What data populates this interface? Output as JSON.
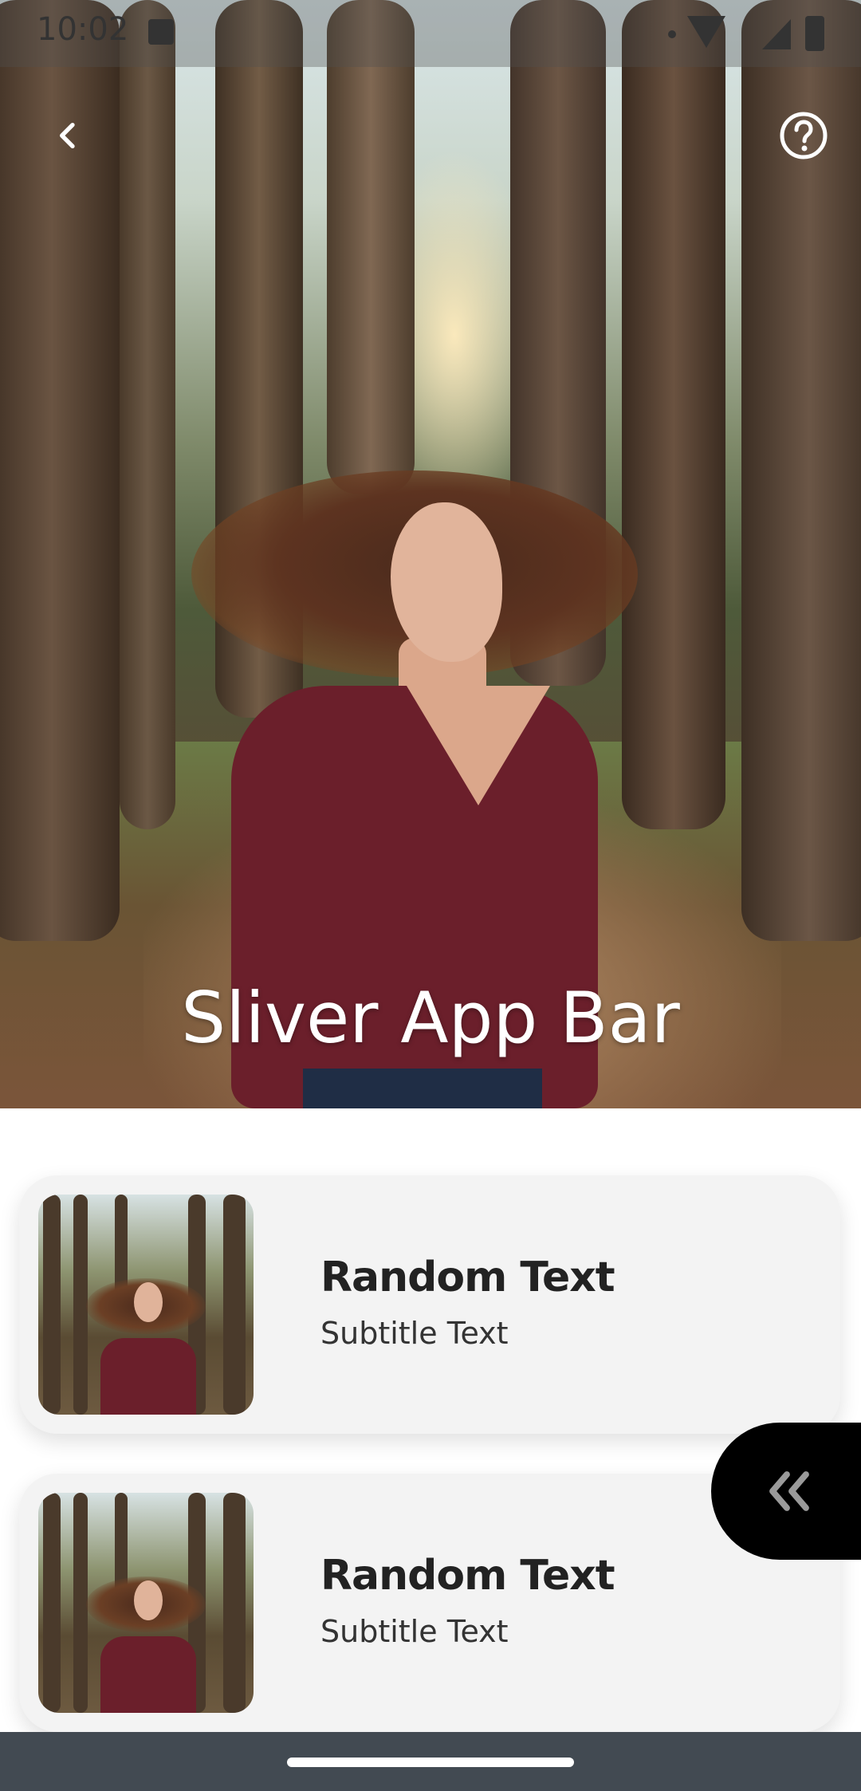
{
  "status_bar": {
    "time": "10:02",
    "icons": [
      "gallery-icon",
      "dot-icon",
      "wifi-icon",
      "signal-icon",
      "battery-icon"
    ]
  },
  "app_bar": {
    "title": "Sliver App Bar",
    "back_icon": "chevron-left-icon",
    "help_icon": "help-circle-icon"
  },
  "list": {
    "items": [
      {
        "title": "Random Text",
        "subtitle": "Subtitle Text",
        "thumbnail": "woman-forest-photo"
      },
      {
        "title": "Random Text",
        "subtitle": "Subtitle Text",
        "thumbnail": "woman-forest-photo"
      }
    ]
  },
  "floating_tab": {
    "icon": "double-chevron-left-icon"
  },
  "colors": {
    "card_background": "#f3f3f3",
    "floating_tab": "#000000",
    "nav_bar": "#424a52",
    "title_text": "#ffffff"
  }
}
